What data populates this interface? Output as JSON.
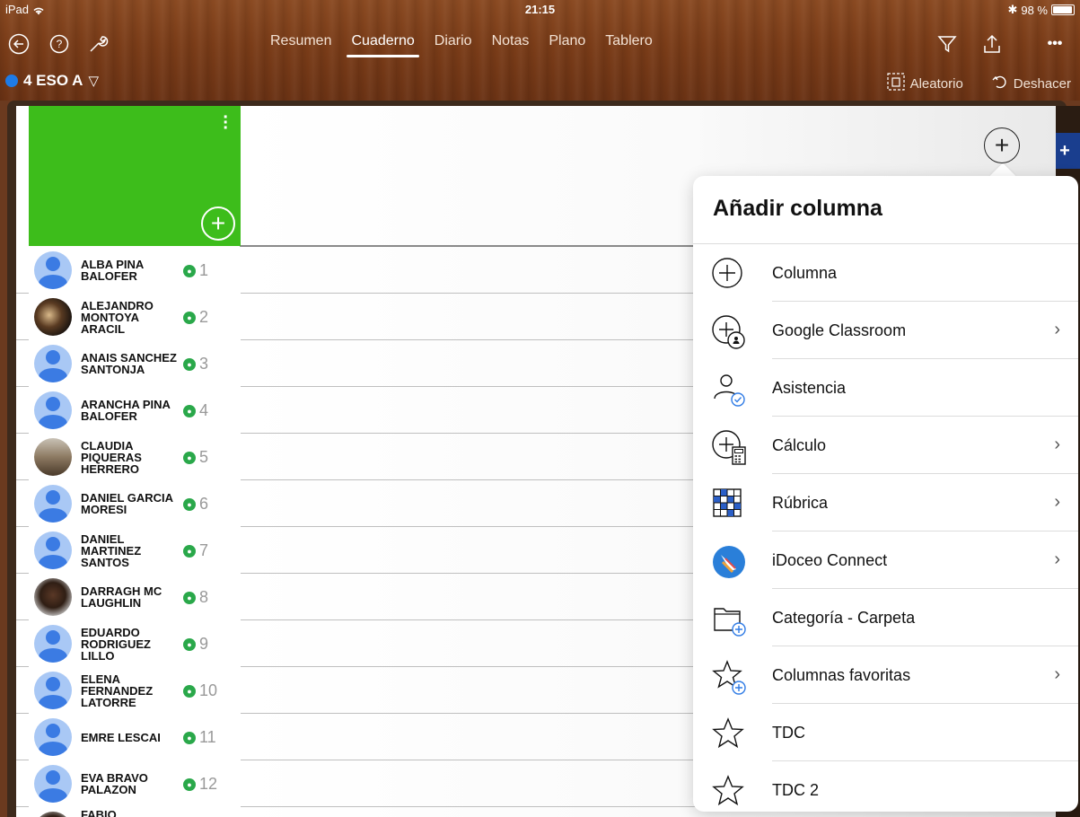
{
  "status_bar": {
    "device": "iPad",
    "time": "21:15",
    "battery": "98 %"
  },
  "toolbar": {
    "tabs": [
      {
        "label": "Resumen"
      },
      {
        "label": "Cuaderno"
      },
      {
        "label": "Diario"
      },
      {
        "label": "Notas"
      },
      {
        "label": "Plano"
      },
      {
        "label": "Tablero"
      }
    ],
    "active_tab": "Cuaderno",
    "more_label": "•••"
  },
  "subbar": {
    "class_name": "4 ESO A",
    "random_label": "Aleatorio",
    "undo_label": "Deshacer"
  },
  "students": [
    {
      "name": "ALBA PINA BALOFER",
      "num": "1",
      "avatar": "default"
    },
    {
      "name": "ALEJANDRO MONTOYA ARACIL",
      "num": "2",
      "avatar": "photo"
    },
    {
      "name": "ANAIS SANCHEZ SANTONJA",
      "num": "3",
      "avatar": "default"
    },
    {
      "name": "ARANCHA PINA BALOFER",
      "num": "4",
      "avatar": "default"
    },
    {
      "name": "CLAUDIA PIQUERAS HERRERO",
      "num": "5",
      "avatar": "photo"
    },
    {
      "name": "DANIEL GARCIA MORESI",
      "num": "6",
      "avatar": "default"
    },
    {
      "name": "DANIEL MARTINEZ SANTOS",
      "num": "7",
      "avatar": "default"
    },
    {
      "name": "DARRAGH MC LAUGHLIN",
      "num": "8",
      "avatar": "photo"
    },
    {
      "name": "EDUARDO RODRIGUEZ LILLO",
      "num": "9",
      "avatar": "default"
    },
    {
      "name": "ELENA FERNANDEZ LATORRE",
      "num": "10",
      "avatar": "default"
    },
    {
      "name": "EMRE LESCAI",
      "num": "11",
      "avatar": "default"
    },
    {
      "name": "EVA BRAVO PALAZON",
      "num": "12",
      "avatar": "default"
    },
    {
      "name": "FABIO",
      "num": "",
      "avatar": "photo"
    }
  ],
  "popover": {
    "title": "Añadir columna",
    "items": [
      {
        "label": "Columna",
        "icon": "plus-circle-icon",
        "has_chevron": false
      },
      {
        "label": "Google Classroom",
        "icon": "google-classroom-icon",
        "has_chevron": true
      },
      {
        "label": "Asistencia",
        "icon": "attendance-icon",
        "has_chevron": false
      },
      {
        "label": "Cálculo",
        "icon": "calculator-icon",
        "has_chevron": true
      },
      {
        "label": "Rúbrica",
        "icon": "rubric-grid-icon",
        "has_chevron": true
      },
      {
        "label": "iDoceo Connect",
        "icon": "idoceo-connect-icon",
        "has_chevron": true
      },
      {
        "label": "Categoría - Carpeta",
        "icon": "folder-plus-icon",
        "has_chevron": false
      },
      {
        "label": "Columnas favoritas",
        "icon": "star-plus-icon",
        "has_chevron": true
      },
      {
        "label": "TDC",
        "icon": "star-icon",
        "has_chevron": false
      },
      {
        "label": "TDC 2",
        "icon": "star-icon",
        "has_chevron": false
      }
    ]
  },
  "colors": {
    "header_green": "#3dbd1b",
    "class_dot": "#1e7be6",
    "avatar_blue": "#3b7be3",
    "google_badge": "#2aa84a"
  }
}
